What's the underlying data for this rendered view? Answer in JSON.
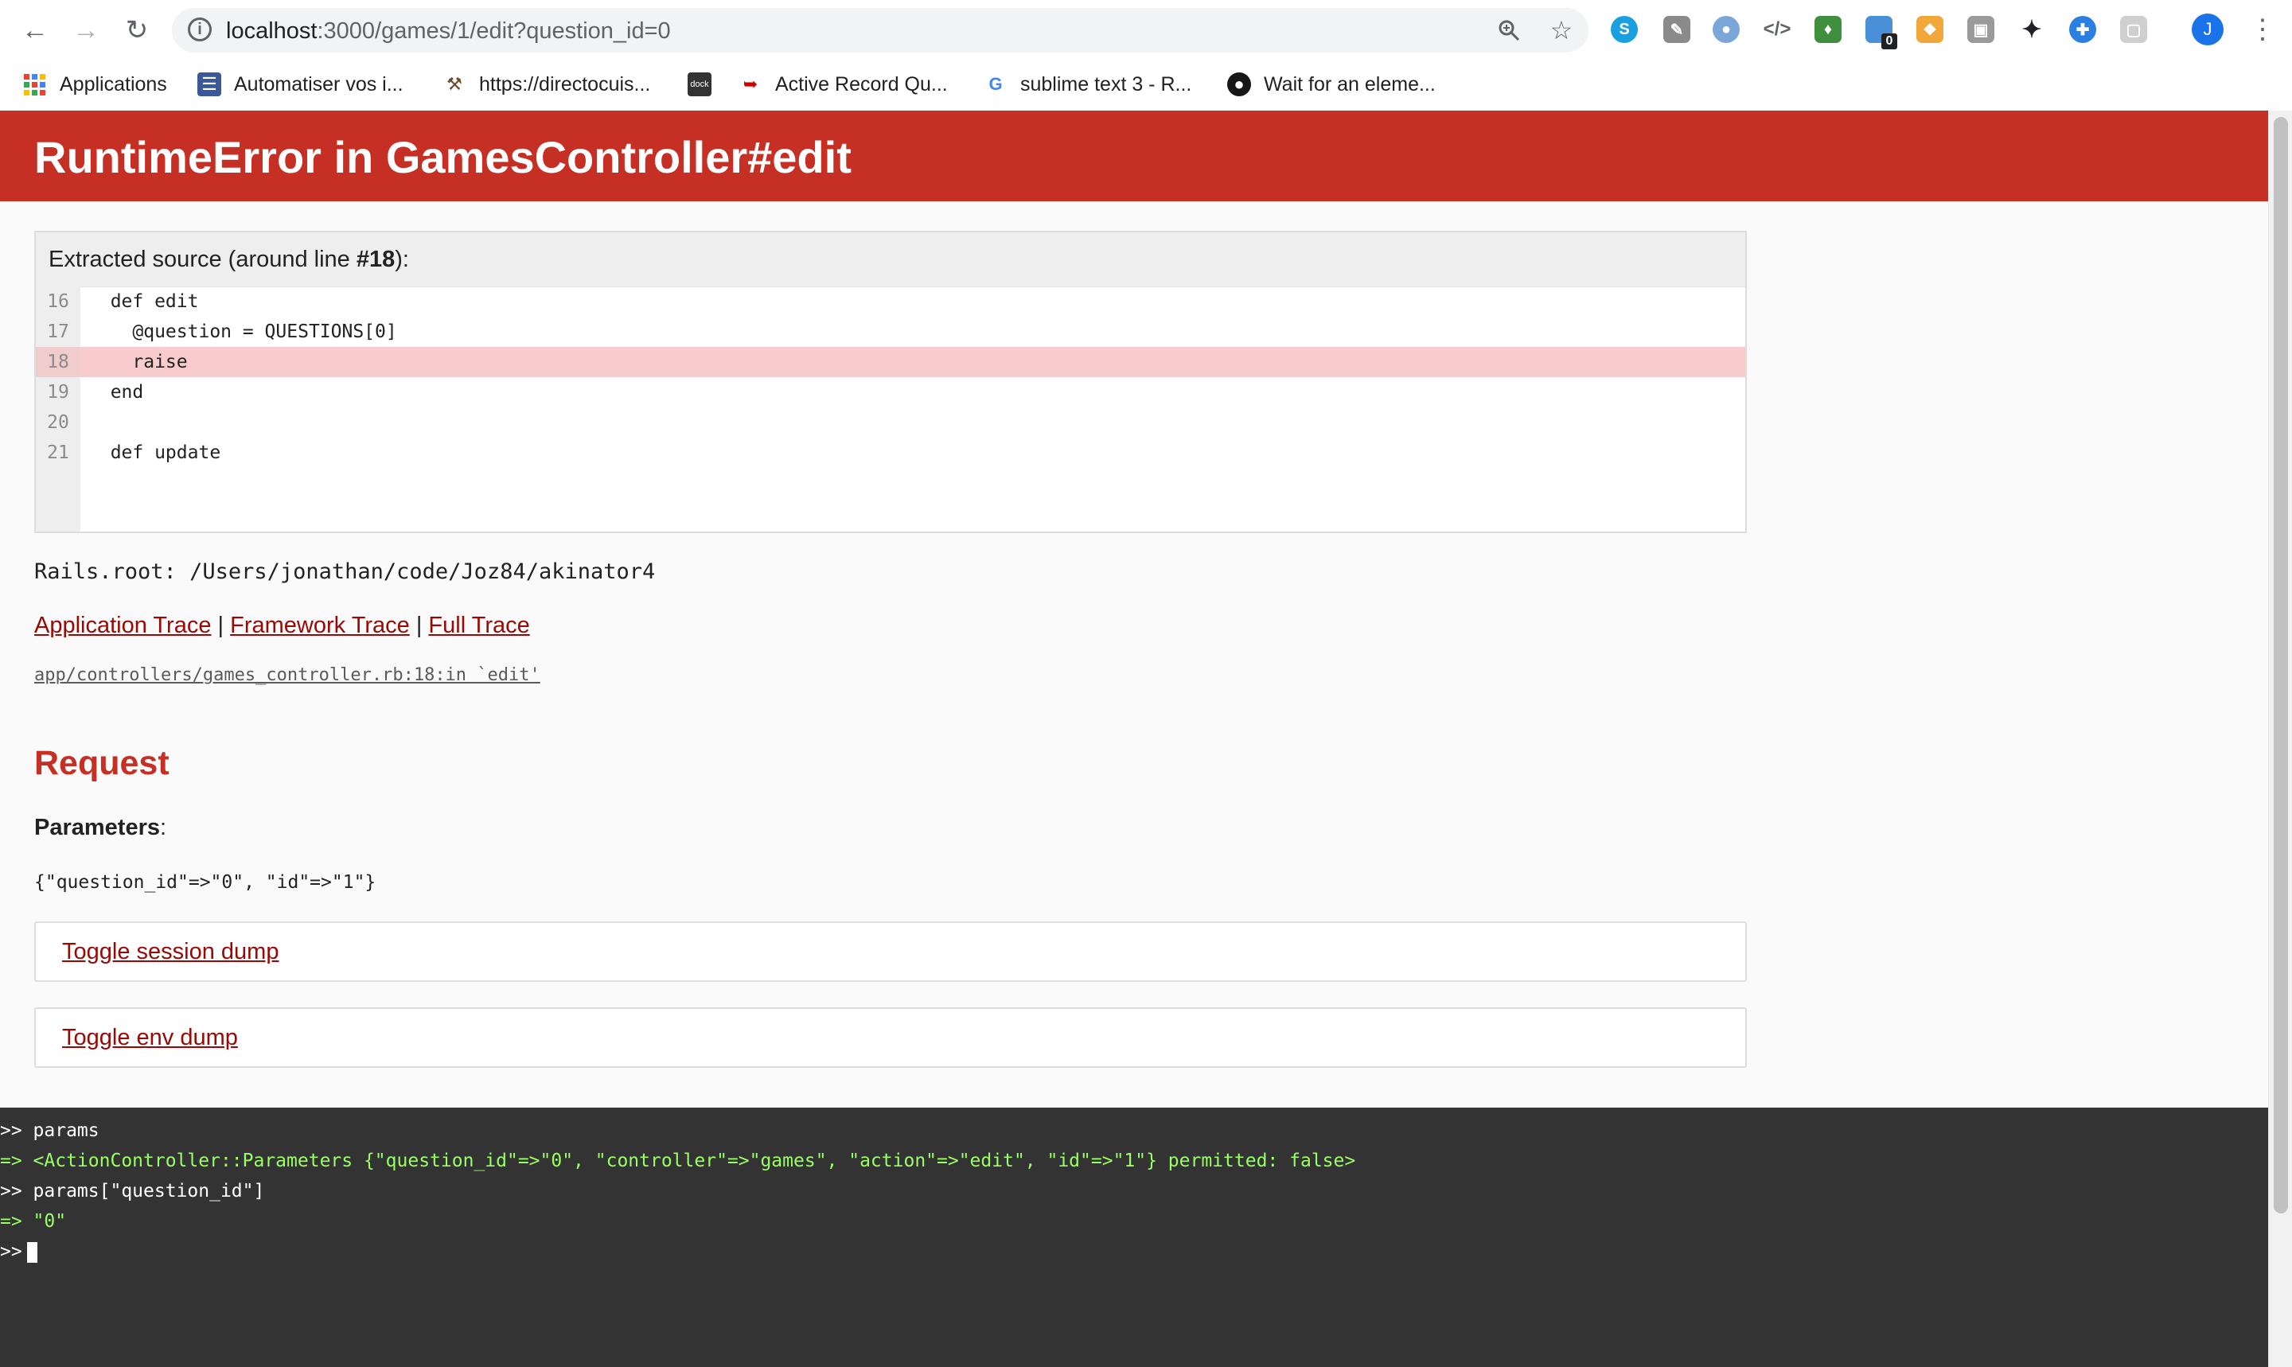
{
  "browser": {
    "url_host": "localhost",
    "url_rest": ":3000/games/1/edit?question_id=0",
    "icons": {
      "back": "back-arrow-icon",
      "forward": "forward-arrow-icon",
      "reload": "reload-icon",
      "info": "info-icon",
      "zoom": "zoom-icon",
      "star": "star-icon",
      "menu": "kebab-menu-icon"
    },
    "extension_badge": "0",
    "avatar_letter": "J",
    "bookmarks": [
      {
        "label": "Applications"
      },
      {
        "label": "Automatiser vos i..."
      },
      {
        "label": "https://directocuis..."
      },
      {
        "label": ""
      },
      {
        "label": "Active Record Qu..."
      },
      {
        "label": "sublime text 3 - R..."
      },
      {
        "label": "Wait for an eleme..."
      }
    ],
    "bookmark_dock_icon_text": "dock"
  },
  "page": {
    "title": "RuntimeError in GamesController#edit",
    "source_heading_prefix": "Extracted source (around line ",
    "source_heading_line": "#18",
    "source_heading_suffix": "):",
    "code_lines": [
      {
        "number": "16",
        "code": "  def edit"
      },
      {
        "number": "17",
        "code": "    @question = QUESTIONS[0]"
      },
      {
        "number": "18",
        "code": "    raise"
      },
      {
        "number": "19",
        "code": "  end"
      },
      {
        "number": "20",
        "code": ""
      },
      {
        "number": "21",
        "code": "  def update"
      }
    ],
    "highlight_line": "18",
    "rails_root": "Rails.root: /Users/jonathan/code/Joz84/akinator4",
    "trace_links": {
      "application": "Application Trace",
      "framework": "Framework Trace",
      "full": "Full Trace",
      "separator": "|"
    },
    "trace_line": "app/controllers/games_controller.rb:18:in `edit'",
    "request_title": "Request",
    "parameters_label": "Parameters",
    "parameters_colon": ":",
    "parameters_value": "{\"question_id\"=>\"0\", \"id\"=>\"1\"}",
    "toggle_session": "Toggle session dump",
    "toggle_env": "Toggle env dump"
  },
  "console": {
    "lines": [
      {
        "kind": "input",
        "text": ">> params"
      },
      {
        "kind": "output",
        "text": "=> <ActionController::Parameters {\"question_id\"=>\"0\", \"controller\"=>\"games\", \"action\"=>\"edit\", \"id\"=>\"1\"} permitted: false>"
      },
      {
        "kind": "input",
        "text": ">> params[\"question_id\"]"
      },
      {
        "kind": "output",
        "text": "=> \"0\""
      },
      {
        "kind": "prompt",
        "text": ">>"
      }
    ]
  },
  "colors": {
    "header_bg": "#c52f24",
    "link": "#980905",
    "highlight_row": "#f8cccc",
    "console_bg": "#333333",
    "console_output": "#99ff66"
  }
}
